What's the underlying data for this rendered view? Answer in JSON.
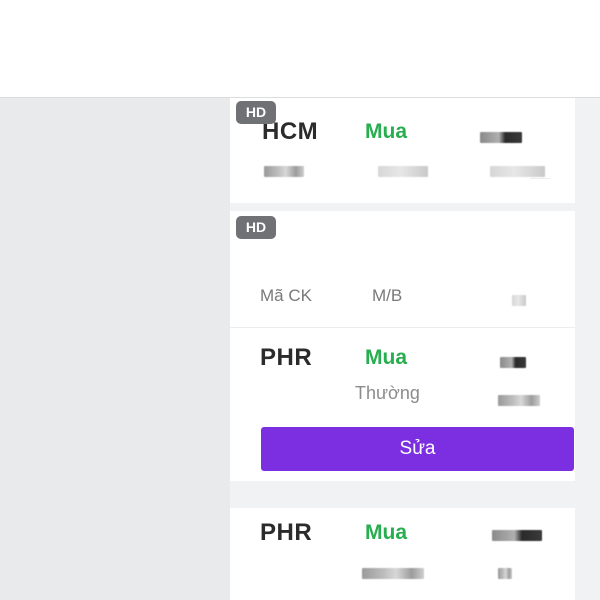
{
  "order_list": {
    "columns": {
      "symbol_label": "Mã CK",
      "side_label": "M/B"
    },
    "orders": [
      {
        "badge": "HD",
        "symbol": "HCM",
        "side": "Mua"
      },
      {
        "badge": "HD",
        "symbol": "PHR",
        "side": "Mua",
        "order_type": "Thường",
        "edit_label": "Sửa"
      },
      {
        "symbol": "PHR",
        "side": "Mua"
      }
    ]
  },
  "colors": {
    "buy_green": "#27ae4f",
    "edit_purple": "#7b2fe0",
    "badge_gray": "#6f7175"
  }
}
